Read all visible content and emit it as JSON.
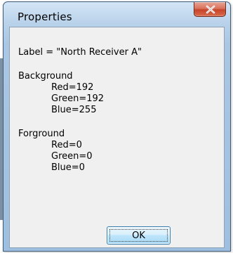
{
  "window": {
    "title": "Properties",
    "close_icon": "close-x-icon"
  },
  "content": {
    "label_line": "Label = \"North Receiver A\"",
    "background": {
      "heading": "Background",
      "red": "Red=192",
      "green": "Green=192",
      "blue": "Blue=255"
    },
    "foreground": {
      "heading": "Forground",
      "red": "Red=0",
      "green": "Green=0",
      "blue": "Blue=0"
    }
  },
  "buttons": {
    "ok_label": "OK"
  },
  "colors": {
    "titlebar": "#b9d2ea",
    "close_button": "#c7442a",
    "client_bg": "#f0f0f0",
    "ok_button": "#bee6fd"
  }
}
